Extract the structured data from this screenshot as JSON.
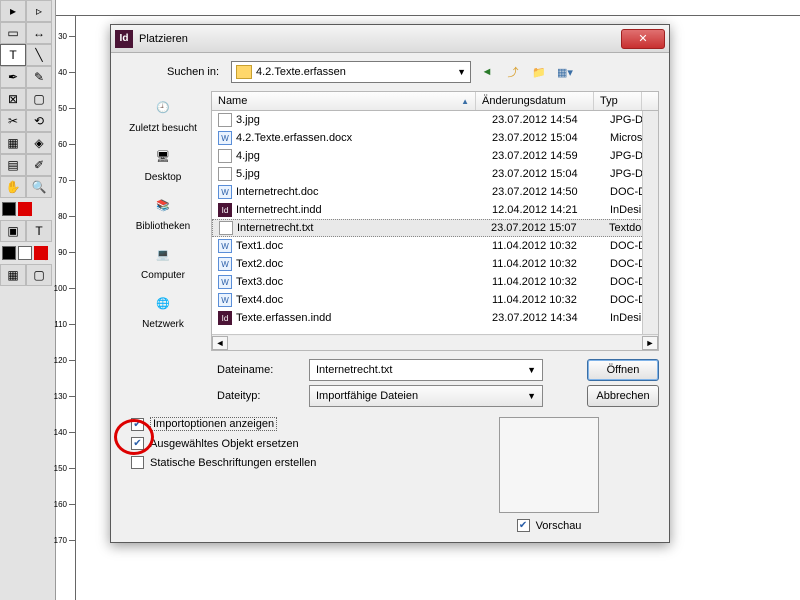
{
  "dialog": {
    "title": "Platzieren",
    "lookin_label": "Suchen in:",
    "lookin_value": "4.2.Texte.erfassen",
    "shortcuts": [
      {
        "label": "Zuletzt besucht"
      },
      {
        "label": "Desktop"
      },
      {
        "label": "Bibliotheken"
      },
      {
        "label": "Computer"
      },
      {
        "label": "Netzwerk"
      }
    ],
    "columns": {
      "name": "Name",
      "date": "Änderungsdatum",
      "type": "Typ"
    },
    "files": [
      {
        "icon": "img",
        "name": "3.jpg",
        "date": "23.07.2012 14:54",
        "type": "JPG-Da"
      },
      {
        "icon": "doc",
        "name": "4.2.Texte.erfassen.docx",
        "date": "23.07.2012 15:04",
        "type": "Micros"
      },
      {
        "icon": "img",
        "name": "4.jpg",
        "date": "23.07.2012 14:59",
        "type": "JPG-Da"
      },
      {
        "icon": "img",
        "name": "5.jpg",
        "date": "23.07.2012 15:04",
        "type": "JPG-Da"
      },
      {
        "icon": "doc",
        "name": "Internetrecht.doc",
        "date": "23.07.2012 14:50",
        "type": "DOC-D"
      },
      {
        "icon": "indd",
        "name": "Internetrecht.indd",
        "date": "12.04.2012 14:21",
        "type": "InDesi"
      },
      {
        "icon": "txt",
        "name": "Internetrecht.txt",
        "date": "23.07.2012 15:07",
        "type": "Textdo",
        "selected": true
      },
      {
        "icon": "doc",
        "name": "Text1.doc",
        "date": "11.04.2012 10:32",
        "type": "DOC-D"
      },
      {
        "icon": "doc",
        "name": "Text2.doc",
        "date": "11.04.2012 10:32",
        "type": "DOC-D"
      },
      {
        "icon": "doc",
        "name": "Text3.doc",
        "date": "11.04.2012 10:32",
        "type": "DOC-D"
      },
      {
        "icon": "doc",
        "name": "Text4.doc",
        "date": "11.04.2012 10:32",
        "type": "DOC-D"
      },
      {
        "icon": "indd",
        "name": "Texte.erfassen.indd",
        "date": "23.07.2012 14:34",
        "type": "InDesi"
      }
    ],
    "filename_label": "Dateiname:",
    "filename_value": "Internetrecht.txt",
    "filetype_label": "Dateityp:",
    "filetype_value": "Importfähige Dateien",
    "open_btn": "Öffnen",
    "cancel_btn": "Abbrechen",
    "opt_import": "Importoptionen anzeigen",
    "opt_replace": "Ausgewähltes Objekt ersetzen",
    "opt_static": "Statische Beschriftungen erstellen",
    "preview_label": "Vorschau"
  },
  "ruler_ticks_v": [
    "30",
    "40",
    "50",
    "60",
    "70",
    "80",
    "90",
    "100",
    "110",
    "120",
    "130",
    "140",
    "150",
    "160",
    "170"
  ]
}
